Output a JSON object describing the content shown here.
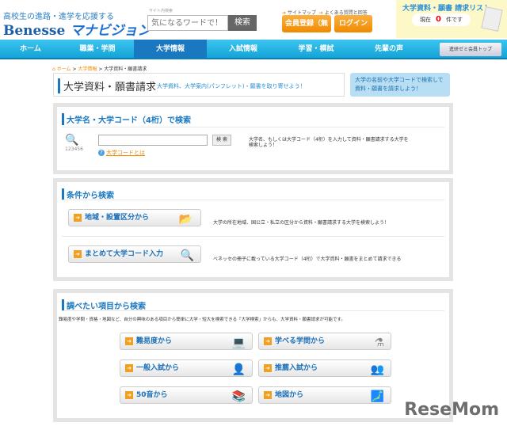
{
  "header": {
    "tagline": "高校生の進路・進学を応援する",
    "brand": "Benesse",
    "brand_sub": "マナビジョン",
    "search_label": "サイト内検索",
    "search_placeholder": "気になるワードで！",
    "search_button": "検索",
    "sitemap": "サイトマップ",
    "faq": "よくある質問と回答",
    "register": "会員登録（無料）",
    "login": "ログイン",
    "request_list_title": "大学資料・願書 請求リスト",
    "count_prefix": "現在",
    "count": "0",
    "count_suffix": "件です"
  },
  "nav": {
    "items": [
      "ホーム",
      "職業・学問",
      "大学情報",
      "入試情報",
      "学習・模試",
      "先輩の声"
    ],
    "member_top": "進研ゼミ会員トップ"
  },
  "breadcrumb": [
    "ホーム",
    "大学情報",
    "大学資料・願書請求"
  ],
  "title": {
    "heading": "大学資料・願書請求",
    "subtitle": "大学資料、大学案内(パンフレット)・願書を取り寄せよう！",
    "bubble": "大学の名前や大学コードで検索して資料・願書を請求しよう！"
  },
  "section1": {
    "heading": "大学名・大学コード（4桁）で検索",
    "input_value": "",
    "search_button": "検 索",
    "help_link": "大学コードとは",
    "desc": "大学名、もしくは大学コード（4桁）を入力して資料・願書請求する大学を",
    "desc2": "検索しよう！",
    "icon_digits": "123456"
  },
  "section2": {
    "heading": "条件から検索",
    "items": [
      {
        "label": "地域・設置区分から",
        "desc": "大学の所在地域、国公立・私立の区分から資料・願書請求する大学を検索しよう！"
      },
      {
        "label": "まとめて大学コード入力",
        "desc": "ベネッセの冊子に載っている大学コード（4桁）で大学資料・願書をまとめて請求できる"
      }
    ]
  },
  "section3": {
    "heading": "調べたい項目から検索",
    "desc": "難易度や学問・資格・地図など、自分の興味のある項目から簡単に大学・短大を検索できる「大学検索」からも、大学資料・願書請求が可能です。",
    "buttons": [
      "難易度から",
      "学べる学問から",
      "一般入試から",
      "推薦入試から",
      "50音から",
      "地図から"
    ]
  },
  "watermark": "ReseMom"
}
